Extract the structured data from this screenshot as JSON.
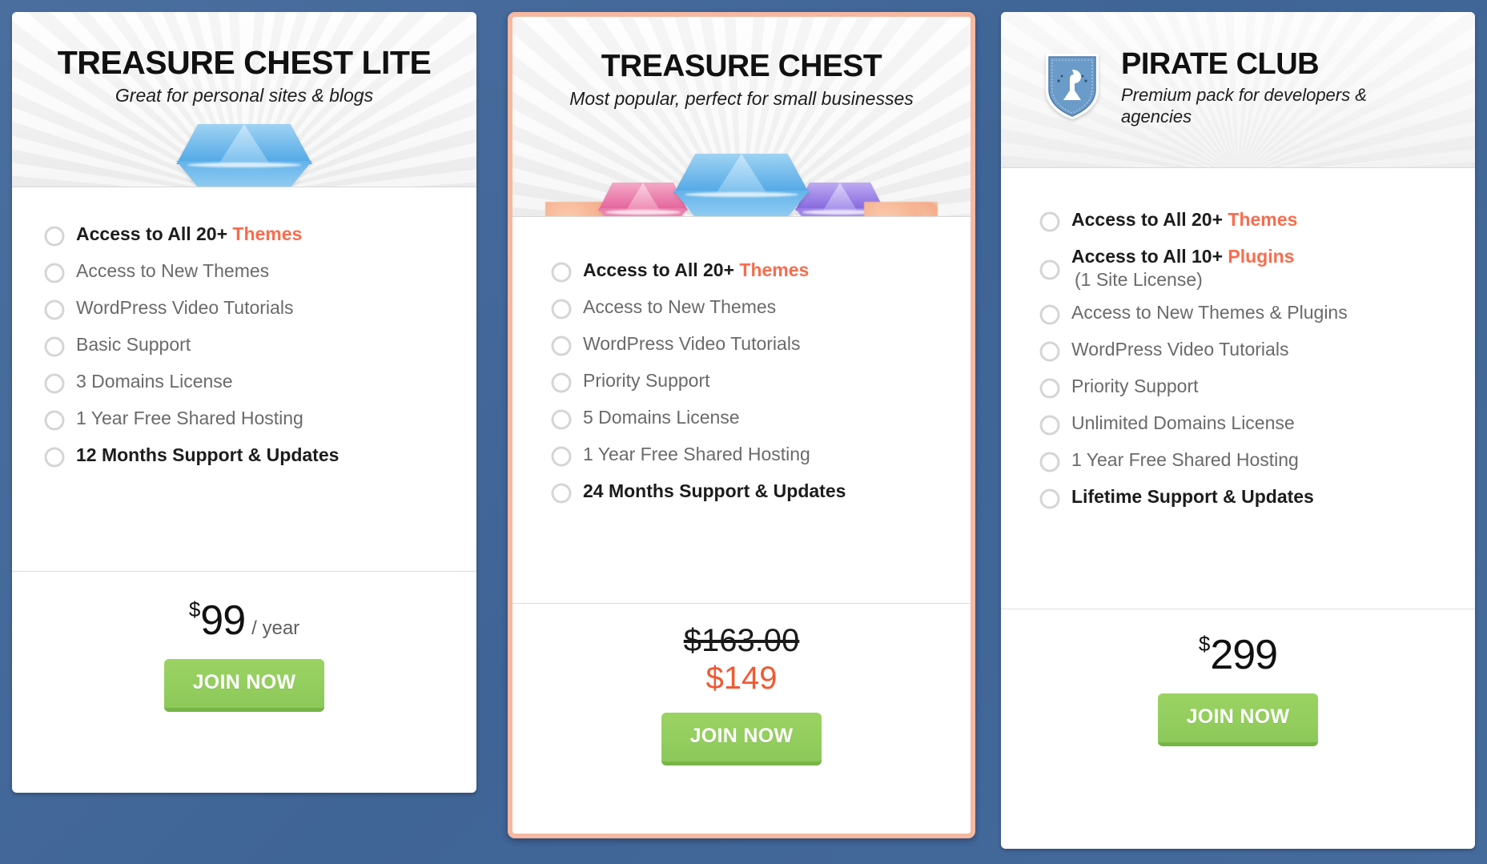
{
  "page": {
    "background_color": "#42679a",
    "accent_color": "#f96c4d",
    "button_color": "#8cc95a",
    "highlight_border_color": "#f5b8a0"
  },
  "plans": [
    {
      "id": "treasure-chest-lite",
      "title": "TREASURE CHEST LITE",
      "subtitle": "Great for personal sites & blogs",
      "artwork": "blue-gem-icon",
      "features": [
        {
          "text": "Access to All 20+ ",
          "accent": "Themes",
          "bold": true,
          "note": ""
        },
        {
          "text": "Access to New Themes",
          "accent": "",
          "bold": false,
          "note": ""
        },
        {
          "text": "WordPress Video Tutorials",
          "accent": "",
          "bold": false,
          "note": ""
        },
        {
          "text": "Basic Support",
          "accent": "",
          "bold": false,
          "note": ""
        },
        {
          "text": "3 Domains License",
          "accent": "",
          "bold": false,
          "note": ""
        },
        {
          "text": "1 Year Free Shared Hosting",
          "accent": "",
          "bold": false,
          "note": ""
        },
        {
          "text": "12 Months Support & Updates",
          "accent": "",
          "bold": true,
          "note": ""
        }
      ],
      "price": {
        "old": "",
        "sale": "",
        "currency": "$",
        "amount": "99",
        "period": "/ year"
      },
      "cta_label": "JOIN NOW"
    },
    {
      "id": "treasure-chest",
      "title": "TREASURE CHEST",
      "subtitle": "Most popular, perfect for small businesses",
      "artwork": "multi-gem-icon",
      "features": [
        {
          "text": "Access to All 20+ ",
          "accent": "Themes",
          "bold": true,
          "note": ""
        },
        {
          "text": "Access to New Themes",
          "accent": "",
          "bold": false,
          "note": ""
        },
        {
          "text": "WordPress Video Tutorials",
          "accent": "",
          "bold": false,
          "note": ""
        },
        {
          "text": "Priority Support",
          "accent": "",
          "bold": false,
          "note": ""
        },
        {
          "text": "5 Domains License",
          "accent": "",
          "bold": false,
          "note": ""
        },
        {
          "text": "1 Year Free Shared Hosting",
          "accent": "",
          "bold": false,
          "note": ""
        },
        {
          "text": "24 Months Support & Updates",
          "accent": "",
          "bold": true,
          "note": ""
        }
      ],
      "price": {
        "old": "$163.00",
        "sale": "$149",
        "currency": "",
        "amount": "",
        "period": ""
      },
      "cta_label": "JOIN NOW"
    },
    {
      "id": "pirate-club",
      "title": "PIRATE CLUB",
      "subtitle": "Premium pack for developers & agencies",
      "artwork": "shield-hook-icon",
      "features": [
        {
          "text": "Access to All 20+ ",
          "accent": "Themes",
          "bold": true,
          "note": ""
        },
        {
          "text": "Access to All 10+ ",
          "accent": "Plugins",
          "bold": true,
          "note": " (1 Site License)"
        },
        {
          "text": "Access to New Themes & Plugins",
          "accent": "",
          "bold": false,
          "note": ""
        },
        {
          "text": "WordPress Video Tutorials",
          "accent": "",
          "bold": false,
          "note": ""
        },
        {
          "text": "Priority Support",
          "accent": "",
          "bold": false,
          "note": ""
        },
        {
          "text": "Unlimited Domains License",
          "accent": "",
          "bold": false,
          "note": ""
        },
        {
          "text": "1 Year Free Shared Hosting",
          "accent": "",
          "bold": false,
          "note": ""
        },
        {
          "text": "Lifetime Support & Updates",
          "accent": "",
          "bold": true,
          "note": ""
        }
      ],
      "price": {
        "old": "",
        "sale": "",
        "currency": "$",
        "amount": "299",
        "period": ""
      },
      "cta_label": "JOIN NOW"
    }
  ]
}
